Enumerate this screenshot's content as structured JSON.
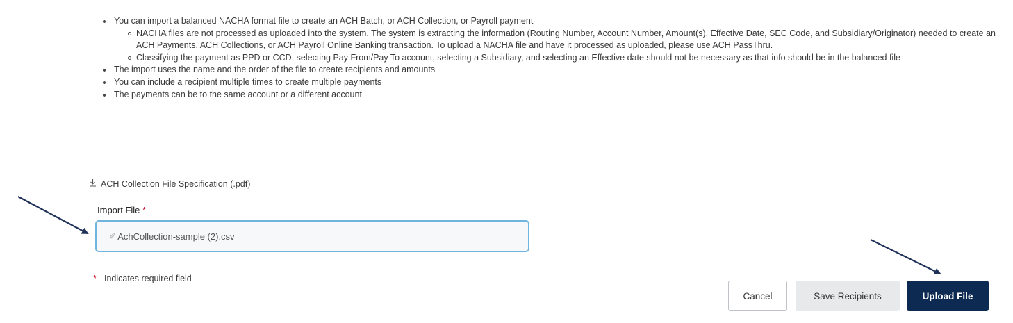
{
  "instructions": {
    "bullets": [
      "You can import a balanced NACHA format file to create an ACH Batch, or ACH Collection, or Payroll payment",
      "The import uses the name and the order of the file to create recipients and amounts",
      "You can include a recipient multiple times to create multiple payments",
      "The payments can be to the same account or a different account"
    ],
    "sub_bullets": [
      "NACHA files are not processed as uploaded into the system. The system is extracting the information (Routing Number, Account Number, Amount(s), Effective Date, SEC Code, and Subsidiary/Originator) needed to create an ACH Payments, ACH Collections, or ACH Payroll Online Banking transaction. To upload a NACHA file and have it processed as uploaded, please use ACH PassThru.",
      "Classifying the payment as PPD or CCD, selecting Pay From/Pay To account, selecting a Subsidiary, and selecting an Effective date should not be necessary as that info should be in the balanced file"
    ]
  },
  "spec_link": {
    "label": "ACH Collection File Specification (.pdf)",
    "icon": "download-icon"
  },
  "import_file": {
    "label": "Import File",
    "required_marker": "*",
    "value": "AchCollection-sample (2).csv",
    "icon": "paperclip-icon"
  },
  "required_note": {
    "marker": "*",
    "text": " - Indicates required field"
  },
  "buttons": {
    "cancel": "Cancel",
    "save_recipients": "Save Recipients",
    "upload_file": "Upload File"
  },
  "colors": {
    "primary": "#0d2a52",
    "required": "#c8102e",
    "focus_border": "#6fb5e0",
    "annotation_arrow": "#1f3158"
  }
}
